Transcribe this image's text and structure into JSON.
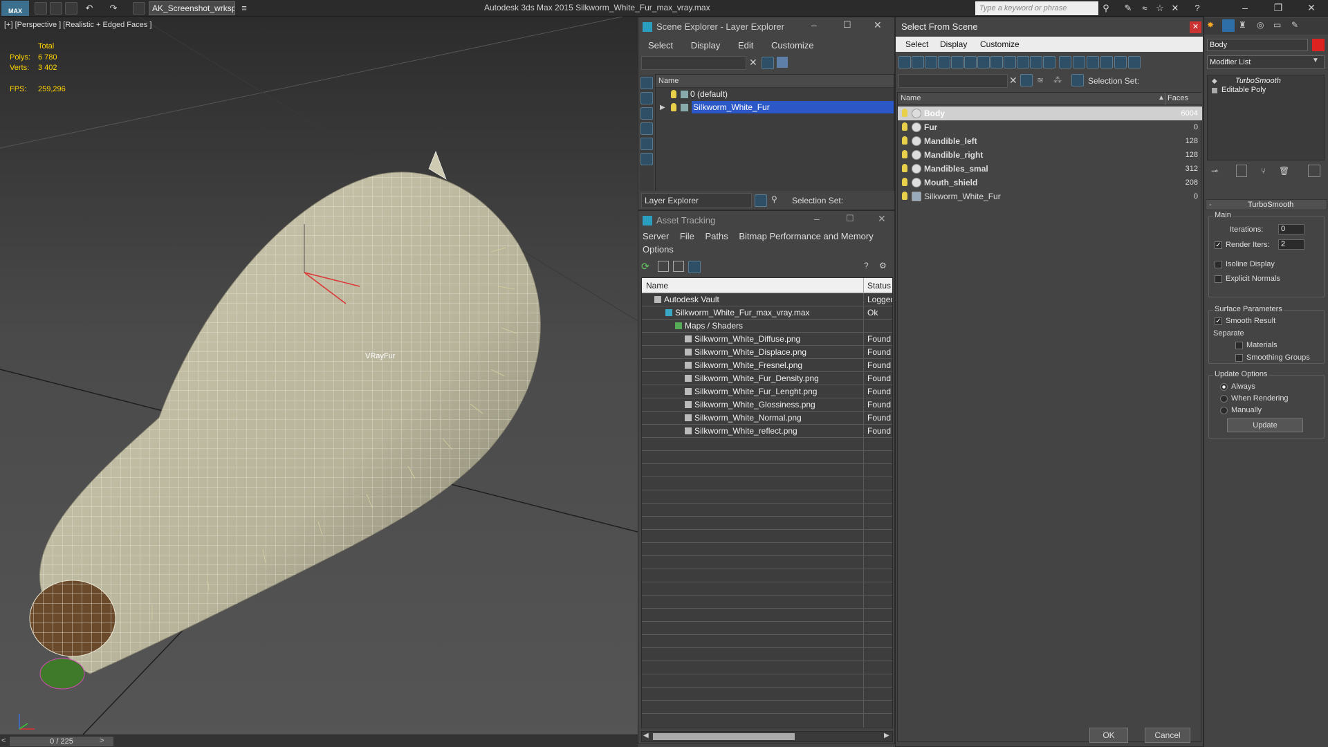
{
  "app": {
    "logo_text": "MAX",
    "workspace": "AK_Screenshot_wrksp",
    "title": "Autodesk 3ds Max  2015    Silkworm_White_Fur_max_vray.max",
    "search_placeholder": "Type a keyword or phrase"
  },
  "viewport": {
    "label": "[+] [Perspective ] [Realistic + Edged Faces ]",
    "stats": {
      "total_label": "Total",
      "polys_label": "Polys:",
      "polys_value": "6 780",
      "verts_label": "Verts:",
      "verts_value": "3 402",
      "fps_label": "FPS:",
      "fps_value": "259,296"
    },
    "object_label": "VRayFur",
    "timeline_frame": "0 / 225"
  },
  "layer_explorer": {
    "title": "Scene Explorer - Layer Explorer",
    "menu": [
      "Select",
      "Display",
      "Edit",
      "Customize"
    ],
    "col_name": "Name",
    "rows": [
      {
        "label": "0 (default)",
        "selected": false
      },
      {
        "label": "Silkworm_White_Fur",
        "selected": true
      }
    ],
    "footer_dropdown": "Layer Explorer",
    "selection_set_label": "Selection Set:"
  },
  "asset_tracking": {
    "title": "Asset Tracking",
    "menu": [
      "Server",
      "File",
      "Paths",
      "Bitmap Performance and Memory"
    ],
    "menu2": "Options",
    "col_name": "Name",
    "col_status": "Status",
    "rows": [
      {
        "name": "Autodesk Vault",
        "status": "Logged",
        "indent": 1
      },
      {
        "name": "Silkworm_White_Fur_max_vray.max",
        "status": "Ok",
        "indent": 2
      },
      {
        "name": "Maps / Shaders",
        "status": "",
        "indent": 3
      },
      {
        "name": "Silkworm_White_Diffuse.png",
        "status": "Found",
        "indent": 4
      },
      {
        "name": "Silkworm_White_Displace.png",
        "status": "Found",
        "indent": 4
      },
      {
        "name": "Silkworm_White_Fresnel.png",
        "status": "Found",
        "indent": 4
      },
      {
        "name": "Silkworm_White_Fur_Density.png",
        "status": "Found",
        "indent": 4
      },
      {
        "name": "Silkworm_White_Fur_Lenght.png",
        "status": "Found",
        "indent": 4
      },
      {
        "name": "Silkworm_White_Glossiness.png",
        "status": "Found",
        "indent": 4
      },
      {
        "name": "Silkworm_White_Normal.png",
        "status": "Found",
        "indent": 4
      },
      {
        "name": "Silkworm_White_reflect.png",
        "status": "Found",
        "indent": 4
      }
    ]
  },
  "select_from_scene": {
    "title": "Select From Scene",
    "menu": [
      "Select",
      "Display",
      "Customize"
    ],
    "selection_set_label": "Selection Set:",
    "col_name": "Name",
    "col_faces": "Faces",
    "rows": [
      {
        "name": "Body",
        "faces": "6004",
        "bold": true,
        "selected": true
      },
      {
        "name": "Fur",
        "faces": "0",
        "bold": true,
        "selected": false
      },
      {
        "name": "Mandible_left",
        "faces": "128",
        "bold": true,
        "selected": false
      },
      {
        "name": "Mandible_right",
        "faces": "128",
        "bold": true,
        "selected": false
      },
      {
        "name": "Mandibles_smal",
        "faces": "312",
        "bold": true,
        "selected": false
      },
      {
        "name": "Mouth_shield",
        "faces": "208",
        "bold": true,
        "selected": false
      },
      {
        "name": "Silkworm_White_Fur",
        "faces": "0",
        "bold": false,
        "selected": false
      }
    ],
    "ok_label": "OK",
    "cancel_label": "Cancel"
  },
  "command_panel": {
    "object_name": "Body",
    "modifier_list": "Modifier List",
    "stack": [
      {
        "label": "TurboSmooth",
        "italic": true
      },
      {
        "label": "Editable Poly",
        "italic": false
      }
    ],
    "rollout_title": "TurboSmooth",
    "main_group": "Main",
    "iterations_label": "Iterations:",
    "iterations_value": "0",
    "render_iters_label": "Render Iters:",
    "render_iters_value": "2",
    "isoline_label": "Isoline Display",
    "explicit_normals_label": "Explicit Normals",
    "surface_group": "Surface Parameters",
    "smooth_result_label": "Smooth Result",
    "separate_label": "Separate",
    "materials_label": "Materials",
    "smoothing_groups_label": "Smoothing Groups",
    "update_group": "Update Options",
    "always_label": "Always",
    "when_rendering_label": "When Rendering",
    "manually_label": "Manually",
    "update_button": "Update"
  },
  "colors": {
    "accent": "#2b57c7",
    "selection_row": "#d0d0d0",
    "fps": "#ffd400",
    "panel": "#444444"
  }
}
